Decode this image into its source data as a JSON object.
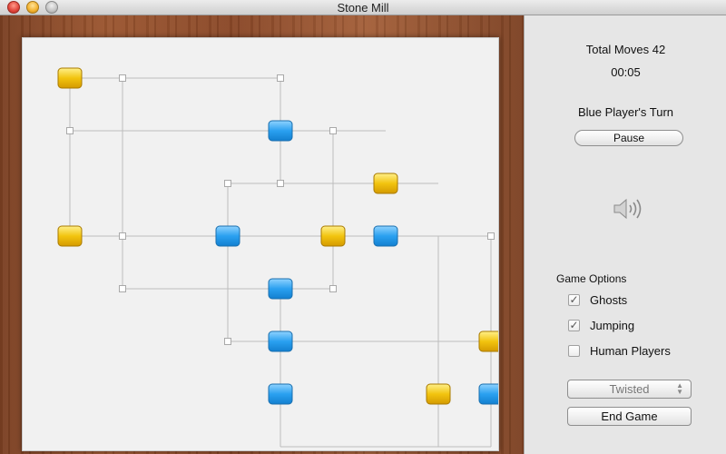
{
  "window": {
    "title": "Stone Mill"
  },
  "status": {
    "total_moves": "Total Moves 42",
    "timer": "00:05",
    "turn": "Blue Player's Turn"
  },
  "controls": {
    "pause_label": "Pause",
    "mode_value": "Twisted",
    "end_label": "End Game"
  },
  "options": {
    "title": "Game Options",
    "items": [
      {
        "label": "Ghosts",
        "checked": true
      },
      {
        "label": "Jumping",
        "checked": true
      },
      {
        "label": "Human Players",
        "checked": false
      }
    ]
  },
  "icons": {
    "sound": "speaker-icon"
  },
  "colors": {
    "blue_stone": "#2aa0f0",
    "yellow_stone": "#f2c40f",
    "line": "#bdbdbd",
    "board": "#f1f1f1"
  },
  "board": {
    "lines": [
      [
        [
          1,
          1
        ],
        [
          5,
          1
        ]
      ],
      [
        [
          1,
          1
        ],
        [
          1,
          4
        ]
      ],
      [
        [
          2,
          1
        ],
        [
          2,
          5
        ]
      ],
      [
        [
          5,
          1
        ],
        [
          5,
          3
        ]
      ],
      [
        [
          1,
          2
        ],
        [
          7,
          2
        ]
      ],
      [
        [
          6,
          2
        ],
        [
          6,
          5
        ]
      ],
      [
        [
          4,
          3
        ],
        [
          8,
          3
        ]
      ],
      [
        [
          4,
          3
        ],
        [
          4,
          6
        ]
      ],
      [
        [
          1,
          4
        ],
        [
          9,
          4
        ]
      ],
      [
        [
          8,
          4
        ],
        [
          8,
          8
        ]
      ],
      [
        [
          9,
          4
        ],
        [
          9,
          8
        ]
      ],
      [
        [
          2,
          5
        ],
        [
          6,
          5
        ]
      ],
      [
        [
          5,
          5
        ],
        [
          5,
          8
        ]
      ],
      [
        [
          4,
          6
        ],
        [
          9,
          6
        ]
      ],
      [
        [
          5,
          8
        ],
        [
          9,
          8
        ]
      ]
    ],
    "points": [
      [
        2,
        1
      ],
      [
        5,
        1
      ],
      [
        1,
        2
      ],
      [
        6,
        2
      ],
      [
        4,
        3
      ],
      [
        5,
        3
      ],
      [
        2,
        4
      ],
      [
        9,
        4
      ],
      [
        2,
        5
      ],
      [
        6,
        5
      ],
      [
        4,
        6
      ]
    ],
    "stones": [
      {
        "col": 1,
        "row": 1,
        "color": "yellow"
      },
      {
        "col": 5,
        "row": 2,
        "color": "blue"
      },
      {
        "col": 7,
        "row": 3,
        "color": "yellow"
      },
      {
        "col": 1,
        "row": 4,
        "color": "yellow"
      },
      {
        "col": 4,
        "row": 4,
        "color": "blue"
      },
      {
        "col": 6,
        "row": 4,
        "color": "yellow"
      },
      {
        "col": 7,
        "row": 4,
        "color": "blue"
      },
      {
        "col": 5,
        "row": 5,
        "color": "blue"
      },
      {
        "col": 5,
        "row": 6,
        "color": "blue"
      },
      {
        "col": 9,
        "row": 6,
        "color": "yellow"
      },
      {
        "col": 5,
        "row": 7,
        "color": "blue"
      },
      {
        "col": 8,
        "row": 7,
        "color": "yellow"
      },
      {
        "col": 9,
        "row": 7,
        "color": "blue"
      }
    ]
  }
}
